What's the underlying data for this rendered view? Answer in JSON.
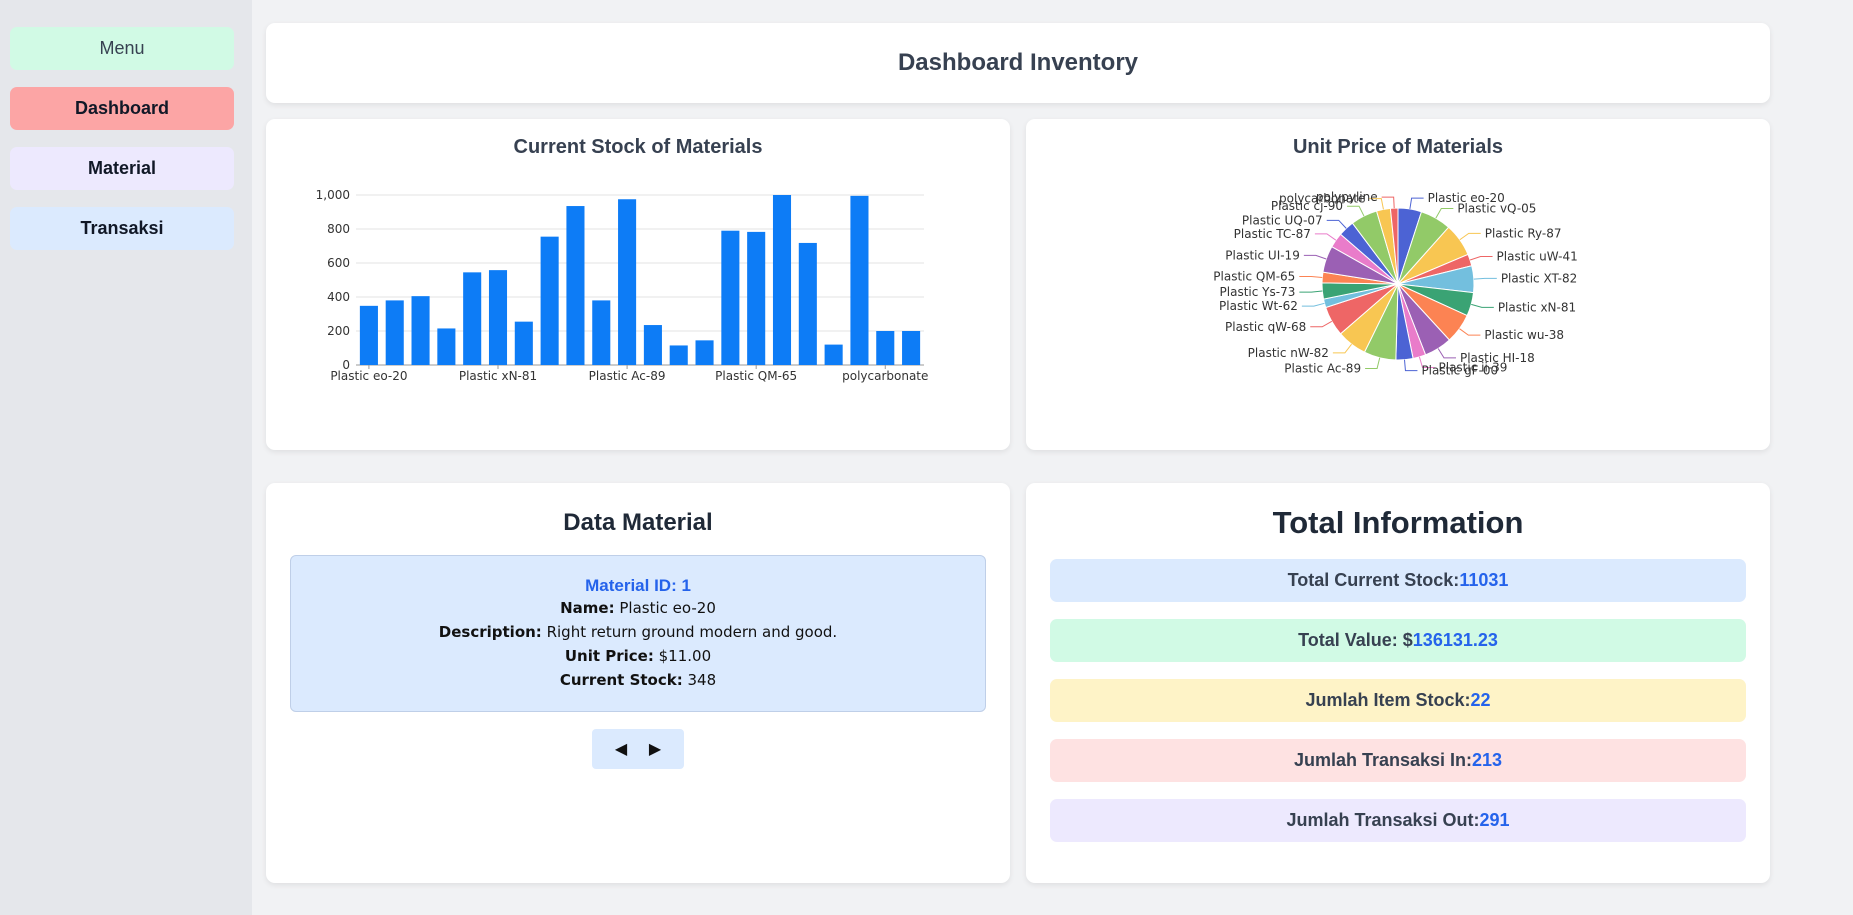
{
  "sidebar": {
    "menu_label": "Menu",
    "items": [
      {
        "label": "Dashboard"
      },
      {
        "label": "Material"
      },
      {
        "label": "Transaksi"
      }
    ]
  },
  "header": {
    "title": "Dashboard Inventory"
  },
  "bar_chart_title": "Current Stock of Materials",
  "pie_chart_title": "Unit Price of Materials",
  "chart_data": [
    {
      "type": "bar",
      "title": "Current Stock of Materials",
      "categories": [
        "Plastic eo-20",
        "Plastic vQ-05",
        "Plastic Ry-87",
        "Plastic uW-41",
        "Plastic XT-82",
        "Plastic xN-81",
        "Plastic wu-38",
        "Plastic HI-18",
        "Plastic ii-39",
        "Plastic gF-00",
        "Plastic Ac-89",
        "Plastic nW-82",
        "Plastic qW-68",
        "Plastic Wt-62",
        "Plastic Ys-73",
        "Plastic QM-65",
        "Plastic UI-19",
        "Plastic TC-87",
        "Plastic UQ-07",
        "Plastic cj-90",
        "polycarbonate",
        "polypyline"
      ],
      "visible_tick_labels": [
        "Plastic eo-20",
        "Plastic xN-81",
        "Plastic Ac-89",
        "Plastic QM-65",
        "polycarbonate"
      ],
      "values": [
        348,
        380,
        405,
        215,
        545,
        558,
        255,
        755,
        935,
        380,
        975,
        235,
        115,
        145,
        790,
        783,
        1000,
        718,
        120,
        995,
        200,
        200
      ],
      "ylim": [
        0,
        1000
      ],
      "yticks": [
        "0",
        "200",
        "400",
        "600",
        "800",
        "1,000"
      ],
      "grid": true,
      "colors": [
        "#0d7cf6"
      ]
    },
    {
      "type": "pie",
      "title": "Unit Price of Materials",
      "slices": [
        {
          "label": "Plastic eo-20",
          "value": 11.0,
          "color": "#4c63d4"
        },
        {
          "label": "Plastic vQ-05",
          "value": 14.5,
          "color": "#92ca68"
        },
        {
          "label": "Plastic Ry-87",
          "value": 15.5,
          "color": "#f8c652"
        },
        {
          "label": "Plastic uW-41",
          "value": 5.5,
          "color": "#ee6666"
        },
        {
          "label": "Plastic XT-82",
          "value": 12.5,
          "color": "#73bfde"
        },
        {
          "label": "Plastic xN-81",
          "value": 11.0,
          "color": "#3aa374"
        },
        {
          "label": "Plastic wu-38",
          "value": 14.0,
          "color": "#fc8353"
        },
        {
          "label": "Plastic HI-18",
          "value": 13.0,
          "color": "#9b60b4"
        },
        {
          "label": "Plastic ii-39",
          "value": 6.0,
          "color": "#e97cca"
        },
        {
          "label": "Plastic gF-00",
          "value": 8.0,
          "color": "#4c63d4"
        },
        {
          "label": "Plastic Ac-89",
          "value": 15.0,
          "color": "#92ca68"
        },
        {
          "label": "Plastic nW-82",
          "value": 14.0,
          "color": "#f8c652"
        },
        {
          "label": "Plastic qW-68",
          "value": 14.0,
          "color": "#ee6666"
        },
        {
          "label": "Plastic Wt-62",
          "value": 4.0,
          "color": "#73bfde"
        },
        {
          "label": "Plastic Ys-73",
          "value": 7.5,
          "color": "#3aa374"
        },
        {
          "label": "Plastic QM-65",
          "value": 5.0,
          "color": "#fc8353"
        },
        {
          "label": "Plastic UI-19",
          "value": 12.5,
          "color": "#9b60b4"
        },
        {
          "label": "Plastic TC-87",
          "value": 7.0,
          "color": "#e97cca"
        },
        {
          "label": "Plastic UQ-07",
          "value": 7.5,
          "color": "#4c63d4"
        },
        {
          "label": "Plastic cj-90",
          "value": 12.5,
          "color": "#92ca68"
        },
        {
          "label": "polycarbonate",
          "value": 6.5,
          "color": "#f8c652"
        },
        {
          "label": "polypyline",
          "value": 3.5,
          "color": "#ee6666"
        }
      ]
    }
  ],
  "data_material": {
    "title": "Data Material",
    "id_text": "Material ID: 1",
    "name_label": "Name:",
    "name_value": "Plastic eo-20",
    "desc_label": "Description:",
    "desc_value": "Right return ground modern and good.",
    "price_label": "Unit Price:",
    "price_value": "$11.00",
    "stock_label": "Current Stock:",
    "stock_value": "348",
    "prev_icon": "triangle-left",
    "next_icon": "triangle-right"
  },
  "total_info": {
    "title": "Total Information",
    "rows": [
      {
        "label": "Total Current Stock: ",
        "value": "11031"
      },
      {
        "label": "Total Value: $",
        "value": "136131.23"
      },
      {
        "label": "Jumlah Item Stock: ",
        "value": "22"
      },
      {
        "label": "Jumlah Transaksi In: ",
        "value": "213"
      },
      {
        "label": "Jumlah Transaksi Out: ",
        "value": "291"
      }
    ]
  }
}
